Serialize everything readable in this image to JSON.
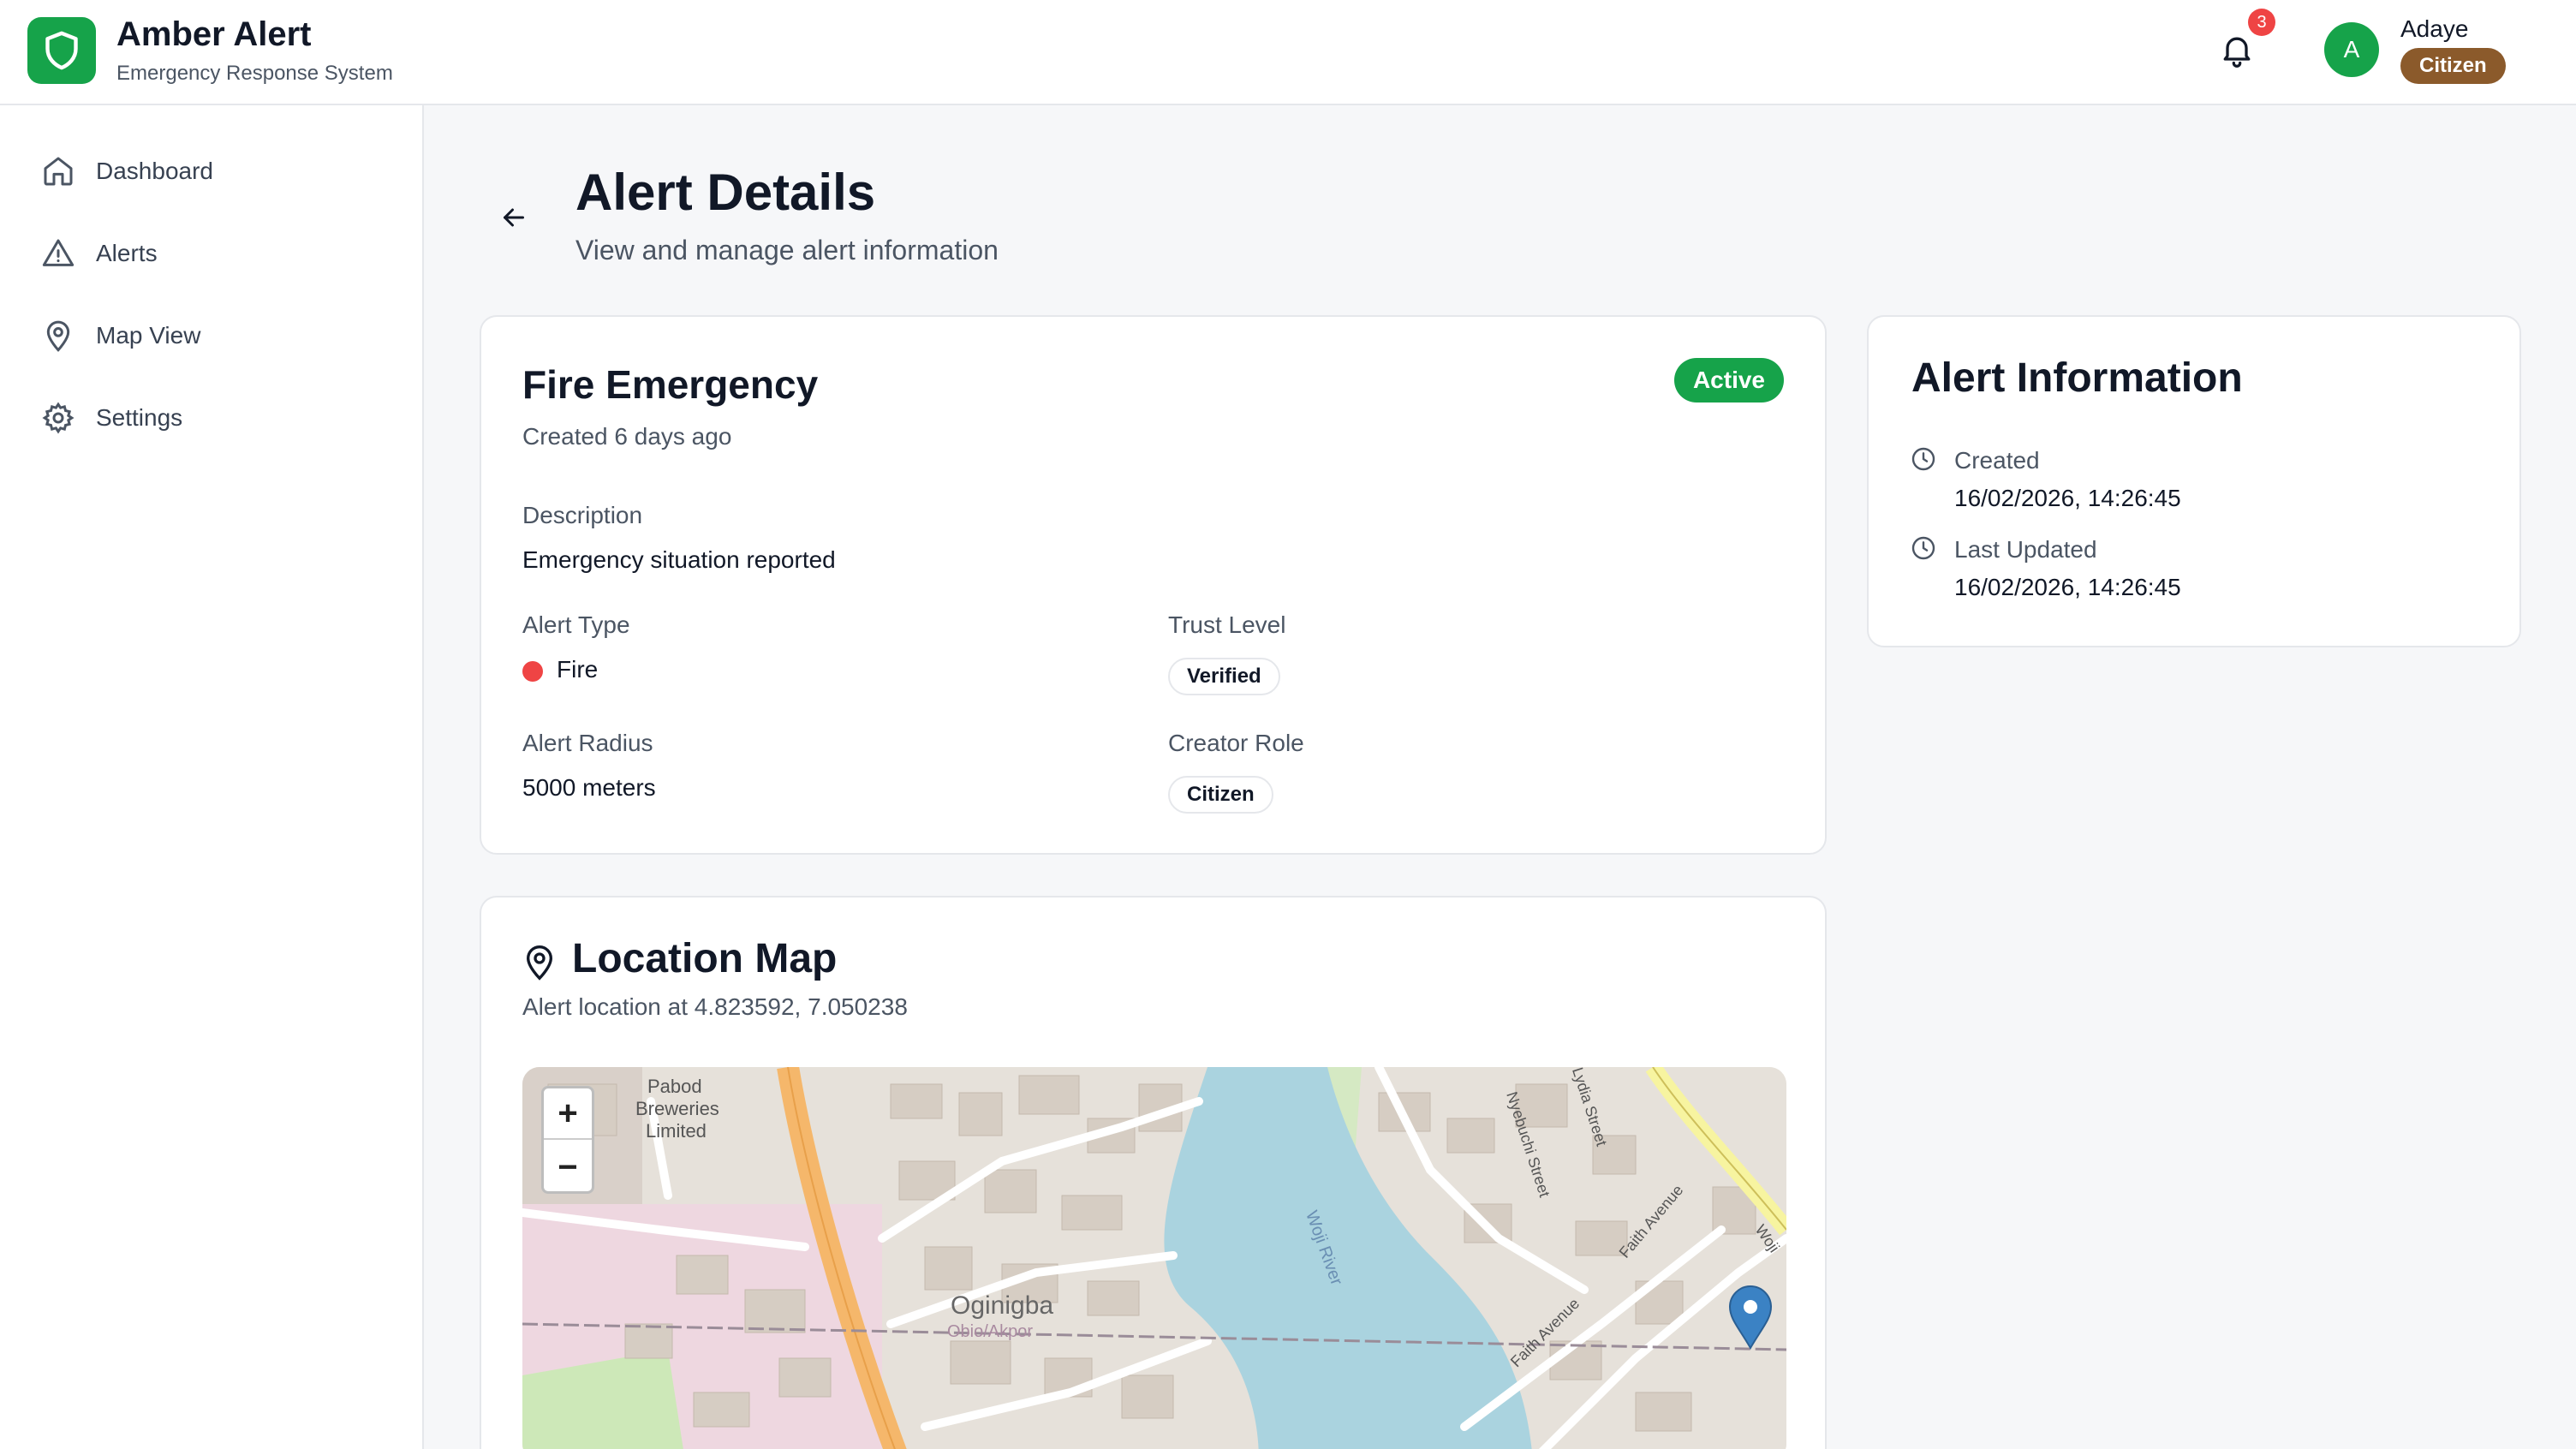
{
  "app": {
    "title": "Amber Alert",
    "subtitle": "Emergency Response System",
    "logo_icon": "shield-icon"
  },
  "header": {
    "notifications_count": "3",
    "user": {
      "initial": "A",
      "name": "Adaye",
      "role": "Citizen"
    }
  },
  "sidebar": {
    "items": [
      {
        "label": "Dashboard",
        "icon": "home-icon"
      },
      {
        "label": "Alerts",
        "icon": "alert-triangle-icon"
      },
      {
        "label": "Map View",
        "icon": "map-pin-icon"
      },
      {
        "label": "Settings",
        "icon": "gear-icon"
      }
    ]
  },
  "page": {
    "title": "Alert Details",
    "subtitle": "View and manage alert information"
  },
  "alert": {
    "title": "Fire Emergency",
    "created": "Created 6 days ago",
    "status": "Active",
    "description_label": "Description",
    "description": "Emergency situation reported",
    "type_label": "Alert Type",
    "type": "Fire",
    "trust_label": "Trust Level",
    "trust": "Verified",
    "radius_label": "Alert Radius",
    "radius": "5000 meters",
    "creator_label": "Creator Role",
    "creator": "Citizen"
  },
  "info": {
    "title": "Alert Information",
    "created_label": "Created",
    "created": "16/02/2026, 14:26:45",
    "updated_label": "Last Updated",
    "updated": "16/02/2026, 14:26:45"
  },
  "map": {
    "title": "Location Map",
    "subtitle": "Alert location at 4.823592, 7.050238",
    "zoom_in": "+",
    "zoom_out": "−",
    "labels": {
      "brewery_1": "Pabod",
      "brewery_2": "Breweries",
      "brewery_3": "Limited",
      "area": "Oginigba",
      "obio": "Obio/Akpor",
      "river": "Woji River",
      "street_1": "Faith Avenue",
      "street_2": "Faith Avenue",
      "street_3": "Nyebuchi Street",
      "street_4": "Lydia Street",
      "woji": "Woji"
    }
  },
  "colors": {
    "accent": "#16a34a",
    "badge_brown": "#8b5a2b",
    "danger": "#ef4444"
  }
}
